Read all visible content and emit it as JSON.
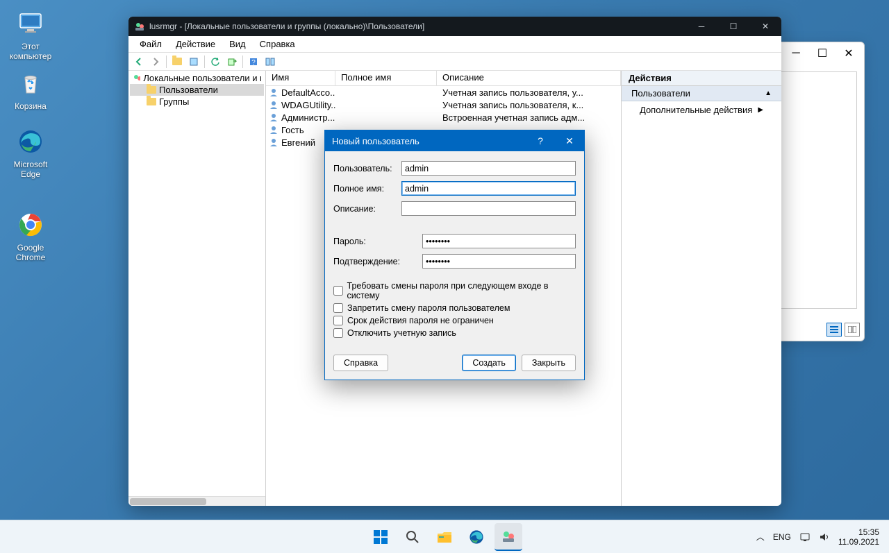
{
  "desktop": {
    "this_pc": "Этот\nкомпьютер",
    "recycle": "Корзина",
    "edge": "Microsoft\nEdge",
    "chrome": "Google\nChrome"
  },
  "app": {
    "title": "lusrmgr - [Локальные пользователи и группы (локально)\\Пользователи]",
    "menu": {
      "file": "Файл",
      "action": "Действие",
      "view": "Вид",
      "help": "Справка"
    },
    "tree": {
      "root": "Локальные пользователи и группы",
      "users": "Пользователи",
      "groups": "Группы"
    },
    "list": {
      "hdr_name": "Имя",
      "hdr_full": "Полное имя",
      "hdr_desc": "Описание",
      "rows": [
        {
          "name": "DefaultAcco...",
          "full": "",
          "desc": "Учетная запись пользователя, у..."
        },
        {
          "name": "WDAGUtility...",
          "full": "",
          "desc": "Учетная запись пользователя, к..."
        },
        {
          "name": "Администр...",
          "full": "",
          "desc": "Встроенная учетная запись адм..."
        },
        {
          "name": "Гость",
          "full": "",
          "desc": ""
        },
        {
          "name": "Евгений",
          "full": "",
          "desc": ""
        }
      ]
    },
    "actions": {
      "header": "Действия",
      "section": "Пользователи",
      "more": "Дополнительные действия"
    }
  },
  "dialog": {
    "title": "Новый пользователь",
    "lbl_user": "Пользователь:",
    "lbl_full": "Полное имя:",
    "lbl_desc": "Описание:",
    "lbl_pwd": "Пароль:",
    "lbl_conf": "Подтверждение:",
    "val_user": "admin",
    "val_full": "admin",
    "val_desc": "",
    "val_pwd": "••••••••",
    "val_conf": "••••••••",
    "chk_must_change": "Требовать смены пароля при следующем входе в систему",
    "chk_cannot_change": "Запретить смену пароля пользователем",
    "chk_never_expires": "Срок действия пароля не ограничен",
    "chk_disabled": "Отключить учетную запись",
    "btn_help": "Справка",
    "btn_create": "Создать",
    "btn_close": "Закрыть"
  },
  "taskbar": {
    "lang": "ENG",
    "time": "15:35",
    "date": "11.09.2021"
  }
}
